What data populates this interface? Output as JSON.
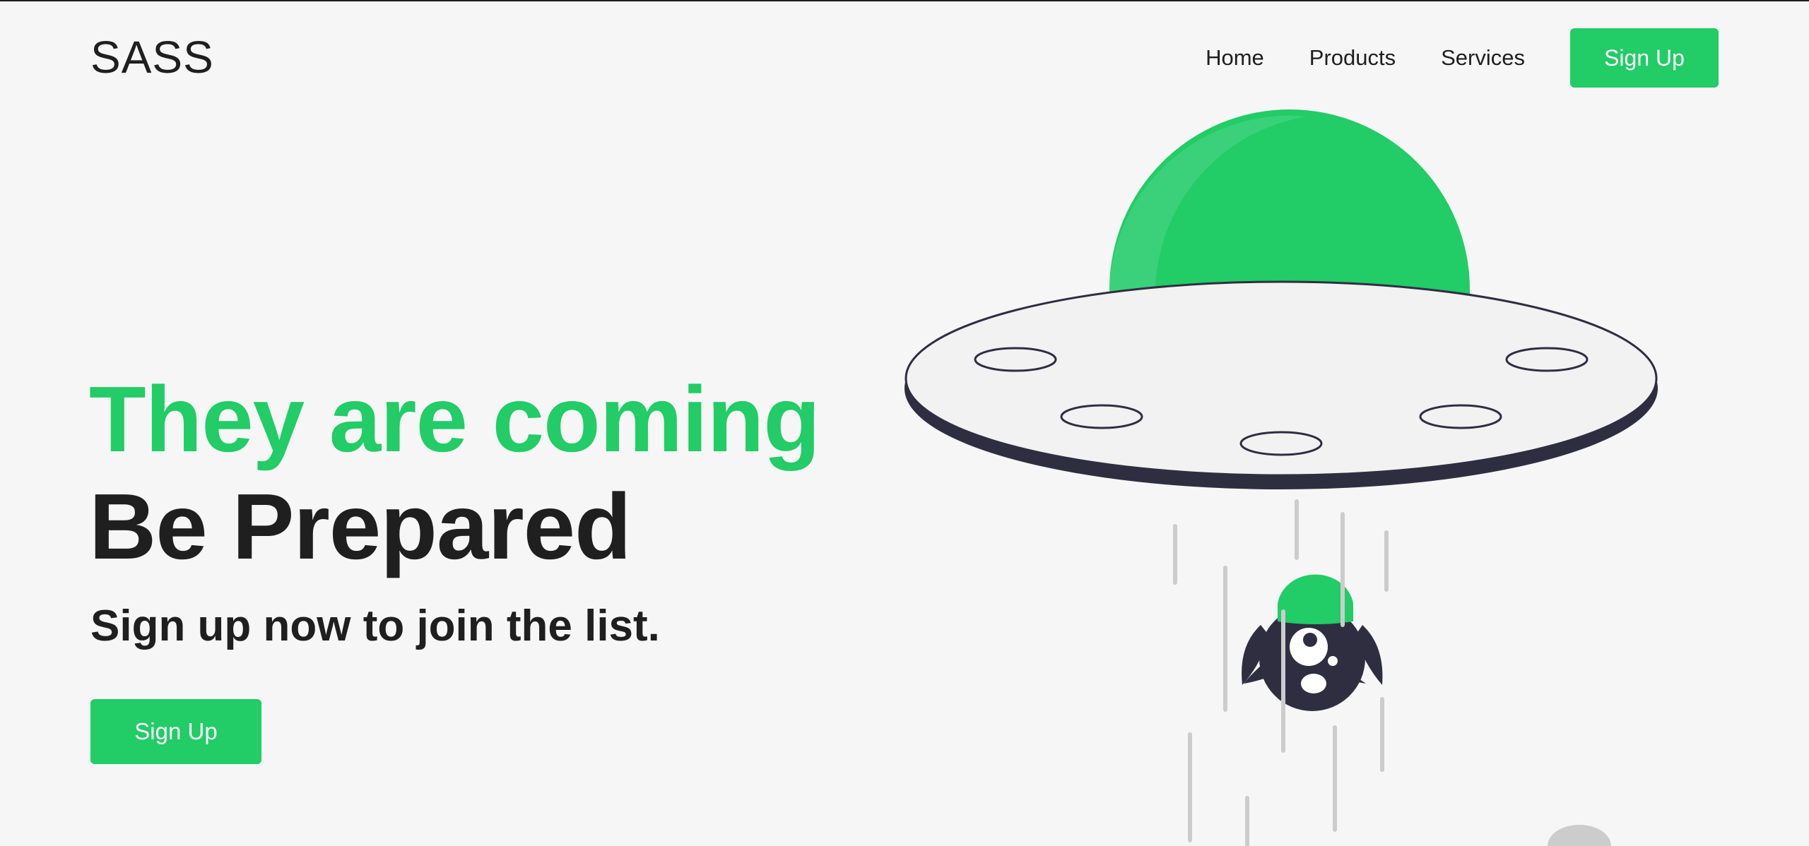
{
  "brand": {
    "logo": "SASS"
  },
  "nav": {
    "items": [
      {
        "label": "Home"
      },
      {
        "label": "Products"
      },
      {
        "label": "Services"
      }
    ],
    "cta_label": "Sign Up"
  },
  "hero": {
    "title_line1": "They are coming",
    "title_line2": "Be Prepared",
    "subtitle": "Sign up now to join the list.",
    "cta_label": "Sign Up"
  },
  "illustration": {
    "subject": "ufo-abducting-monster",
    "colors": {
      "accent": "#22cc66",
      "accent_light": "#3ad17a",
      "dark": "#2f2e41",
      "saucer": "#f2f2f2",
      "beam": "#cccccc"
    }
  },
  "theme": {
    "background": "#f6f6f6",
    "text": "#1f1f1f",
    "accent": "#22cc66"
  }
}
